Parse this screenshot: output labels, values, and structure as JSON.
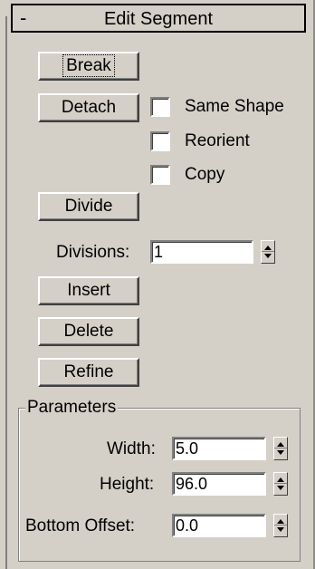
{
  "rollout": {
    "collapse_symbol": "-",
    "title": "Edit Segment"
  },
  "buttons": {
    "break": "Break",
    "detach": "Detach",
    "divide": "Divide",
    "insert": "Insert",
    "delete": "Delete",
    "refine": "Refine"
  },
  "detach_options": [
    {
      "label": "Same Shape",
      "checked": false
    },
    {
      "label": "Reorient",
      "checked": false
    },
    {
      "label": "Copy",
      "checked": false
    }
  ],
  "divisions": {
    "label": "Divisions:",
    "value": "1"
  },
  "parameters": {
    "title": "Parameters",
    "width": {
      "label": "Width:",
      "value": "5.0"
    },
    "height": {
      "label": "Height:",
      "value": "96.0"
    },
    "bottom_offset": {
      "label": "Bottom Offset:",
      "value": "0.0"
    }
  }
}
